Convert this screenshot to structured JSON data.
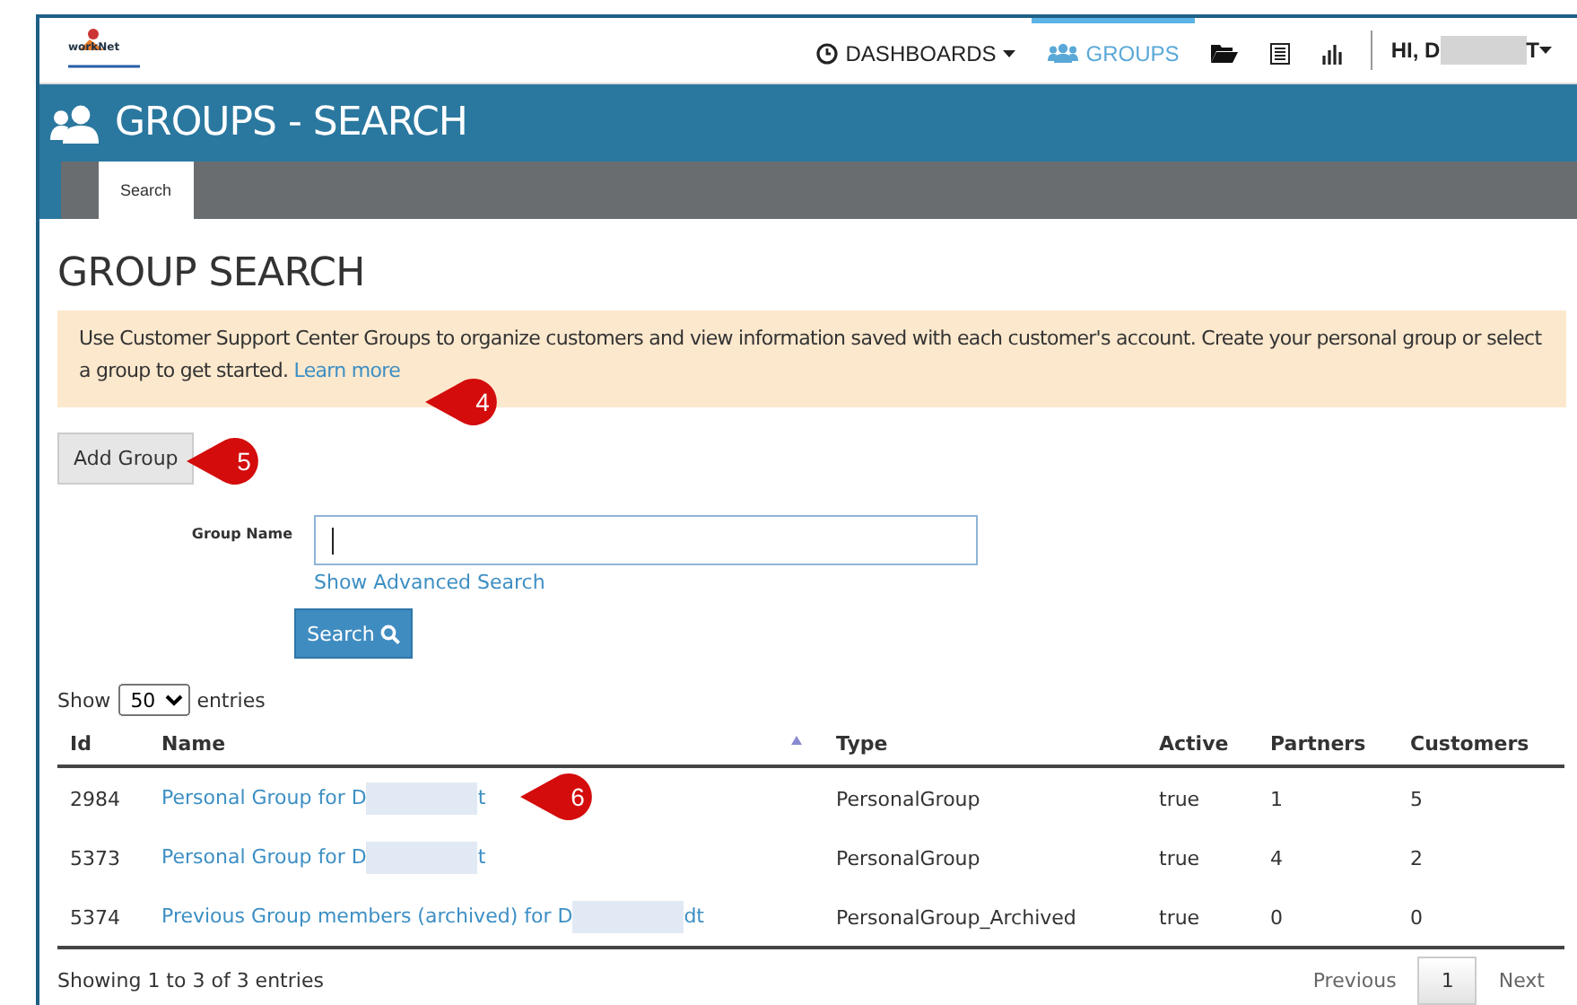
{
  "logo": {
    "text": "workNet"
  },
  "nav": {
    "items": [
      {
        "kind": "dropdown",
        "label": "DASHBOARDS",
        "selected": false
      },
      {
        "kind": "link",
        "label": "GROUPS",
        "selected": true
      },
      {
        "kind": "icon",
        "selected": false
      },
      {
        "kind": "icon",
        "selected": false
      },
      {
        "kind": "icon",
        "selected": false
      }
    ],
    "user": {
      "greeting_start": "HI, D",
      "greeting_end": "T"
    }
  },
  "banner": {
    "title": "GROUPS - SEARCH"
  },
  "tabs": [
    {
      "label": "Search",
      "selected": true
    }
  ],
  "heading": "GROUP SEARCH",
  "alert": {
    "text": "Use Customer Support Center Groups to organize customers and view information saved with each customer's account. Create your personal group or select a group to get started.",
    "link": "Learn more"
  },
  "add_button": "Add Group",
  "search_form": {
    "label": "Group Name",
    "focused": true,
    "advanced_link": "Show Advanced Search",
    "button": "Search"
  },
  "table": {
    "show_label": "Show",
    "page_size": "50",
    "entries_label": "entries",
    "columns": [
      {
        "label": "Id",
        "sorted": false
      },
      {
        "label": "Name",
        "sorted": true
      },
      {
        "label": "Type",
        "sorted": false
      },
      {
        "label": "Active",
        "sorted": false
      },
      {
        "label": "Partners",
        "sorted": false
      },
      {
        "label": "Customers",
        "sorted": false
      }
    ],
    "rows": [
      {
        "id": "2984",
        "name": "Personal Group for D",
        "name_end": "t",
        "type": "PersonalGroup",
        "active": "true",
        "partners": "1",
        "customers": "5"
      },
      {
        "id": "5373",
        "name": "Personal Group for D",
        "name_end": "t",
        "type": "PersonalGroup",
        "active": "true",
        "partners": "4",
        "customers": "2"
      },
      {
        "id": "5374",
        "name": "Previous Group members (archived) for D",
        "name_end": "dt",
        "type": "PersonalGroup_Archived",
        "active": "true",
        "partners": "0",
        "customers": "0"
      }
    ],
    "summary": "Showing 1 to 3 of 3 entries",
    "pagination": {
      "previous": "Previous",
      "pages": [
        {
          "label": "1",
          "selected": true
        }
      ],
      "next": "Next"
    }
  },
  "callouts": [
    {
      "number": "4"
    },
    {
      "number": "5"
    },
    {
      "number": "6"
    }
  ]
}
